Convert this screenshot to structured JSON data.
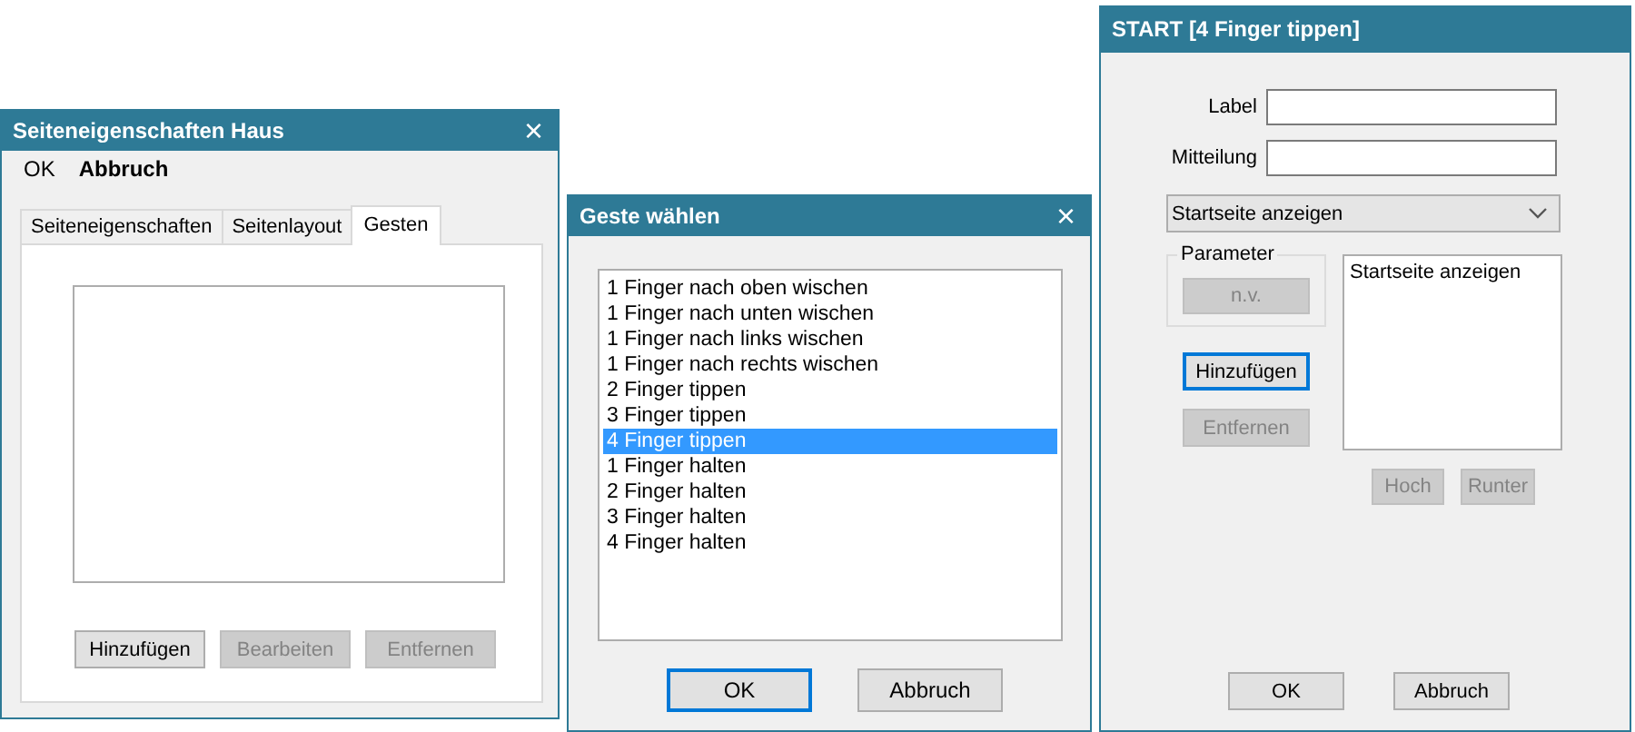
{
  "properties_window": {
    "title": "Seiteneigenschaften Haus",
    "close": "×",
    "menu": [
      "OK",
      "Abbruch"
    ],
    "tabs": [
      {
        "label": "Seiteneigenschaften",
        "selected": false
      },
      {
        "label": "Seitenlayout",
        "selected": false
      },
      {
        "label": "Gesten",
        "selected": true
      }
    ],
    "buttons": [
      {
        "label": "Hinzufügen",
        "disabled": false
      },
      {
        "label": "Bearbeiten",
        "disabled": true
      },
      {
        "label": "Entfernen",
        "disabled": true
      }
    ]
  },
  "gesture_dialog": {
    "title": "Geste wählen",
    "close": "×",
    "items": [
      {
        "label": "1 Finger nach oben wischen",
        "selected": false
      },
      {
        "label": "1 Finger nach unten wischen",
        "selected": false
      },
      {
        "label": "1 Finger nach links wischen",
        "selected": false
      },
      {
        "label": "1 Finger nach rechts wischen",
        "selected": false
      },
      {
        "label": "2 Finger tippen",
        "selected": false
      },
      {
        "label": "3 Finger tippen",
        "selected": false
      },
      {
        "label": "4 Finger tippen",
        "selected": true
      },
      {
        "label": "1 Finger halten",
        "selected": false
      },
      {
        "label": "2 Finger halten",
        "selected": false
      },
      {
        "label": "3 Finger halten",
        "selected": false
      },
      {
        "label": "4 Finger halten",
        "selected": false
      }
    ],
    "buttons": [
      {
        "label": "OK",
        "focused": true
      },
      {
        "label": "Abbruch",
        "focused": false
      }
    ]
  },
  "action_dialog": {
    "title": "START [4 Finger tippen]",
    "fields": [
      {
        "label": "Label"
      },
      {
        "label": "Mitteilung"
      }
    ],
    "dropdown": {
      "value": "Startseite anzeigen"
    },
    "parameter_group": {
      "title": "Parameter",
      "button": {
        "label": "n.v.",
        "disabled": true
      }
    },
    "side_buttons": [
      {
        "label": "Hinzufügen",
        "disabled": false,
        "focused": true
      },
      {
        "label": "Entfernen",
        "disabled": true,
        "focused": false
      }
    ],
    "actions": [
      "Startseite anzeigen"
    ],
    "order_buttons": [
      {
        "label": "Hoch",
        "disabled": true
      },
      {
        "label": "Runter",
        "disabled": true
      }
    ],
    "buttons": [
      {
        "label": "OK"
      },
      {
        "label": "Abbruch"
      }
    ]
  }
}
